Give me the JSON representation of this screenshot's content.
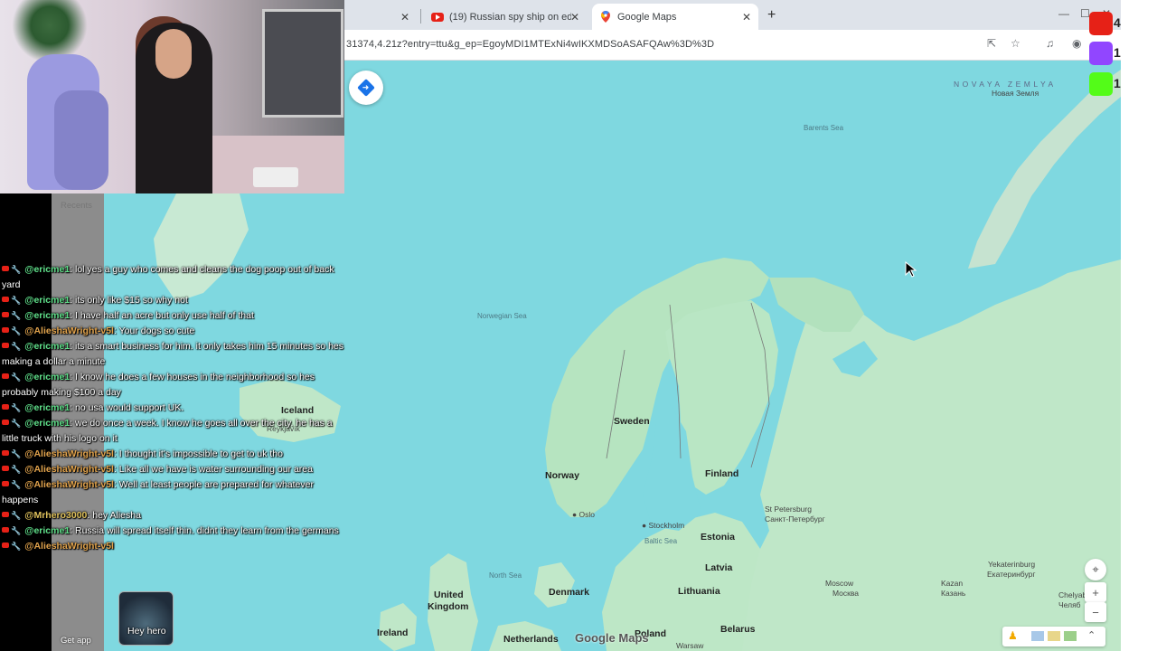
{
  "browser": {
    "tabs": [
      {
        "title": "",
        "active": false
      },
      {
        "title": "(19) Russian spy ship on ed",
        "active": false,
        "icon": "youtube-icon"
      },
      {
        "title": "Google Maps",
        "active": true,
        "icon": "google-maps-icon"
      }
    ],
    "new_tab": "+",
    "url": "31374,4.21z?entry=ttu&g_ep=EgoyMDI1MTExNi4wIKXMDSoASAFQAw%3D%3D"
  },
  "map": {
    "labels": {
      "novaya": "NOVAYA ZEMLYA",
      "novaya_ru": "Новая Земля",
      "barents": "Barents Sea",
      "norwegian": "Norwegian Sea",
      "iceland": "Iceland",
      "reykjavik": "Reykjavík",
      "sweden": "Sweden",
      "finland": "Finland",
      "norway": "Norway",
      "oslo": "Oslo",
      "stockholm": "Stockholm",
      "spb": "St Petersburg",
      "spb_ru": "Санкт-Петербург",
      "estonia": "Estonia",
      "baltic": "Baltic Sea",
      "latvia": "Latvia",
      "north_sea": "North Sea",
      "denmark": "Denmark",
      "lithuania": "Lithuania",
      "uk": "United Kingdom",
      "moscow": "Moscow",
      "moscow_ru": "Москва",
      "kazan": "Kazan",
      "kazan_ru": "Казань",
      "yekaterinburg": "Yekaterinburg",
      "yekaterinburg_ru": "Екатеринбург",
      "chelyabinsk": "Chelyab",
      "chelyabinsk_ru": "Челяб",
      "ireland": "Ireland",
      "netherlands": "Netherlands",
      "poland": "Poland",
      "belarus": "Belarus",
      "warsaw": "Warsaw"
    },
    "logo": "Google Maps"
  },
  "overlay": {
    "youtube_count": "4",
    "twitch_count": "1",
    "kick_count": "1",
    "colors": {
      "youtube": "#e62117",
      "twitch": "#9146ff",
      "kick": "#53fc18"
    }
  },
  "sidebar": {
    "recents": "Recents",
    "get_app": "Get app",
    "thumb_label": "Hey hero"
  },
  "chat": [
    {
      "user": "@ericme1",
      "color": "#5fe08a",
      "text": ": lol yes a guy who comes and cleans the dog poop out of back yard"
    },
    {
      "user": "@ericme1",
      "color": "#5fe08a",
      "text": ": its only like $15 so why not"
    },
    {
      "user": "@ericme1",
      "color": "#5fe08a",
      "text": ": I have half an acre but only use half of that"
    },
    {
      "user": "@AlieshaWright-v5l",
      "color": "#e0a24c",
      "text": ": Your dogs so cute"
    },
    {
      "user": "@ericme1",
      "color": "#5fe08a",
      "text": ": its a smart business for him. it only takes him 15 minutes so hes making a dollar a minute"
    },
    {
      "user": "@ericme1",
      "color": "#5fe08a",
      "text": ": I know he does a few houses in the neighborhood so hes probably making $100 a day"
    },
    {
      "user": "@ericme1",
      "color": "#5fe08a",
      "text": ": no usa would support UK."
    },
    {
      "user": "@ericme1",
      "color": "#5fe08a",
      "text": ": we do once a week. I know he goes all over the city. he has a little truck with his logo on it"
    },
    {
      "user": "@AlieshaWright-v5l",
      "color": "#e0a24c",
      "text": ": I thought it's impossible to get to uk tho"
    },
    {
      "user": "@AlieshaWright-v5l",
      "color": "#e0a24c",
      "text": ": Like all we have is water surrounding our area"
    },
    {
      "user": "@AlieshaWright-v5l",
      "color": "#e0a24c",
      "text": ": Well at least people are prepared for whatever happens"
    },
    {
      "user": "@Mrhero3000",
      "color": "#e0c25c",
      "text": ": hey Aliesha"
    },
    {
      "user": "@ericme1",
      "color": "#5fe08a",
      "text": ": Russia will spread itself thin. didnt they learn from the germans"
    },
    {
      "user": "@AlieshaWright-v5l",
      "color": "#e0a24c",
      "text": ""
    }
  ]
}
